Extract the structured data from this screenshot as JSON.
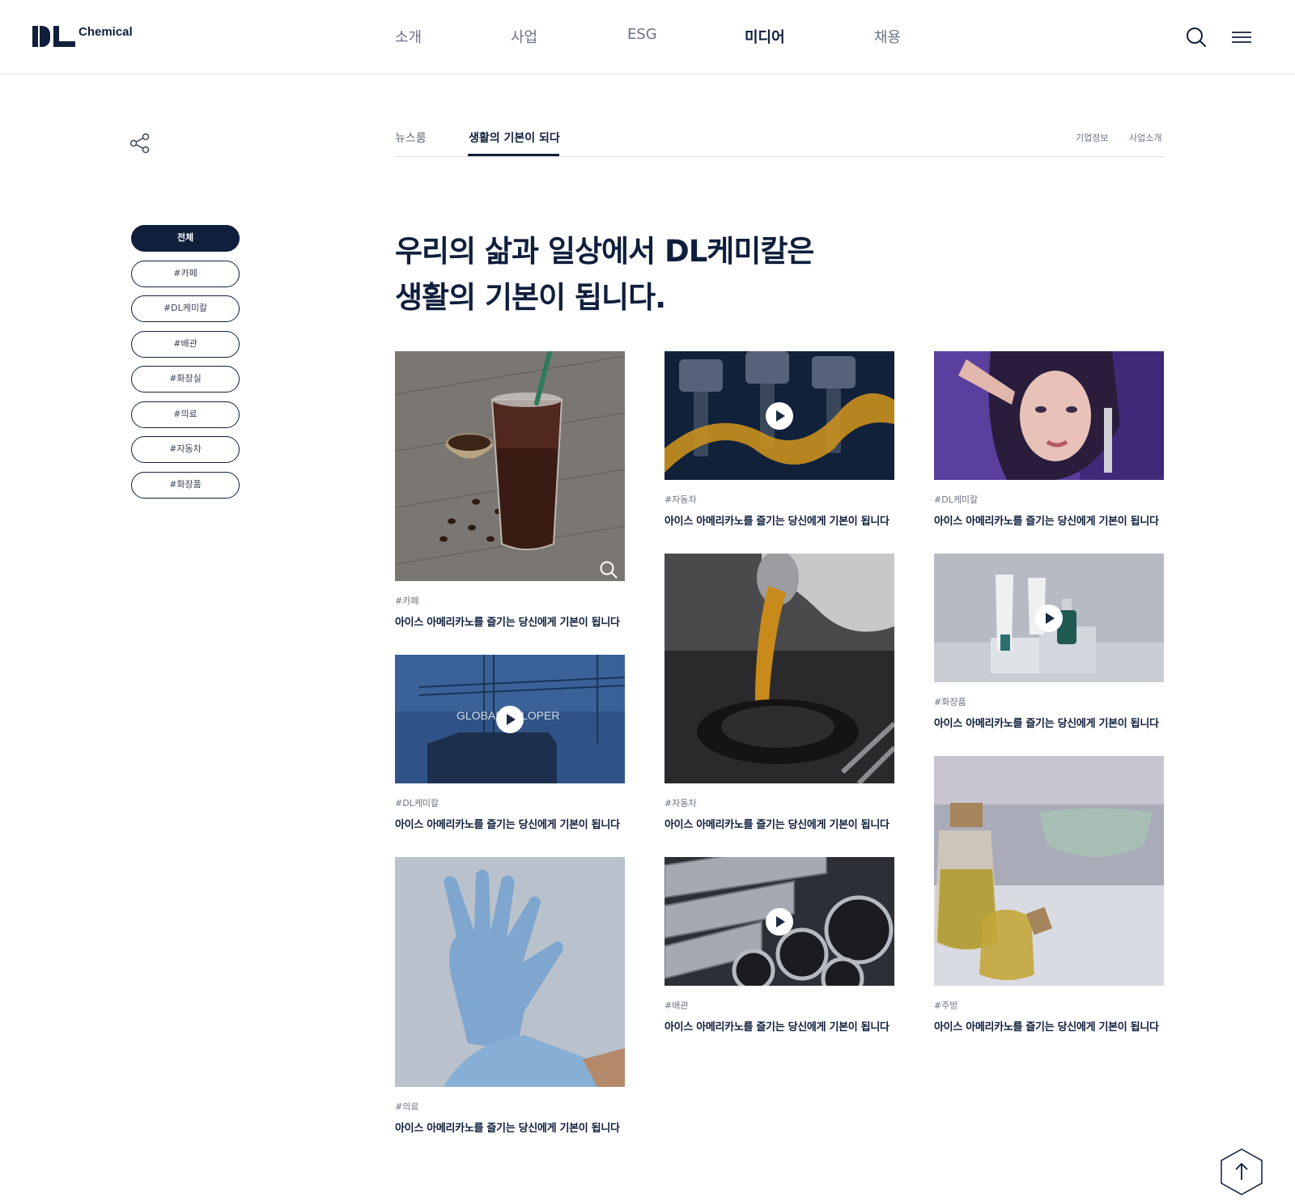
{
  "brand": {
    "name": "Chemical"
  },
  "nav": {
    "items": [
      {
        "label": "소개",
        "active": false
      },
      {
        "label": "사업",
        "active": false
      },
      {
        "label": "ESG",
        "active": false
      },
      {
        "label": "미디어",
        "active": true
      },
      {
        "label": "채용",
        "active": false
      }
    ],
    "search_icon": "search-icon",
    "menu_icon": "hamburger-menu-icon"
  },
  "share_icon": "share-icon",
  "subnav": {
    "tabs": [
      {
        "label": "뉴스룸",
        "active": false
      },
      {
        "label": "생활의 기본이 되다",
        "active": true
      }
    ],
    "links": [
      "기업정보",
      "사업소개"
    ]
  },
  "heading": {
    "line1": "우리의 삶과 일상에서 DL케미칼은",
    "line2": "생활의 기본이 됩니다."
  },
  "filters": [
    {
      "label": "전체",
      "active": true
    },
    {
      "label": "#카페",
      "active": false
    },
    {
      "label": "#DL케미칼",
      "active": false
    },
    {
      "label": "#배관",
      "active": false
    },
    {
      "label": "#화장실",
      "active": false
    },
    {
      "label": "#의료",
      "active": false
    },
    {
      "label": "#자동차",
      "active": false
    },
    {
      "label": "#화장품",
      "active": false
    }
  ],
  "cards": [
    {
      "tag": "#카페",
      "title": "아이스 아메리카노를 즐기는 당신에게 기본이 됩니다",
      "media": "image",
      "subject": "iced-coffee",
      "icon": "zoom-icon"
    },
    {
      "tag": "#DL케미칼",
      "title": "아이스 아메리카노를 즐기는 당신에게 기본이 됩니다",
      "media": "video",
      "subject": "construction-crane",
      "overlay_text": "GLOBAL",
      "overlay_text2": "LOPER"
    },
    {
      "tag": "#의료",
      "title": "아이스 아메리카노를 즐기는 당신에게 기본이 됩니다",
      "media": "image",
      "subject": "medical-gloves"
    },
    {
      "tag": "#자동차",
      "title": "아이스 아메리카노를 즐기는 당신에게 기본이 됩니다",
      "media": "video",
      "subject": "engine-pistons"
    },
    {
      "tag": "#자동차",
      "title": "아이스 아메리카노를 즐기는 당신에게 기본이 됩니다",
      "media": "image",
      "subject": "engine-oil-pour"
    },
    {
      "tag": "#배관",
      "title": "아이스 아메리카노를 즐기는 당신에게 기본이 됩니다",
      "media": "video",
      "subject": "steel-pipes"
    },
    {
      "tag": "#DL케미칼",
      "title": "아이스 아메리카노를 즐기는 당신에게 기본이 됩니다",
      "media": "image",
      "subject": "model-portrait"
    },
    {
      "tag": "#화장품",
      "title": "아이스 아메리카노를 즐기는 당신에게 기본이 됩니다",
      "media": "video",
      "subject": "cosmetic-bottles"
    },
    {
      "tag": "#주방",
      "title": "아이스 아메리카노를 즐기는 당신에게 기본이 됩니다",
      "media": "image",
      "subject": "oil-bottles"
    }
  ],
  "scroll_top_icon": "arrow-up-icon",
  "colors": {
    "navy": "#0f1f3c",
    "muted": "#6b7383",
    "border": "#dcdfe4"
  }
}
